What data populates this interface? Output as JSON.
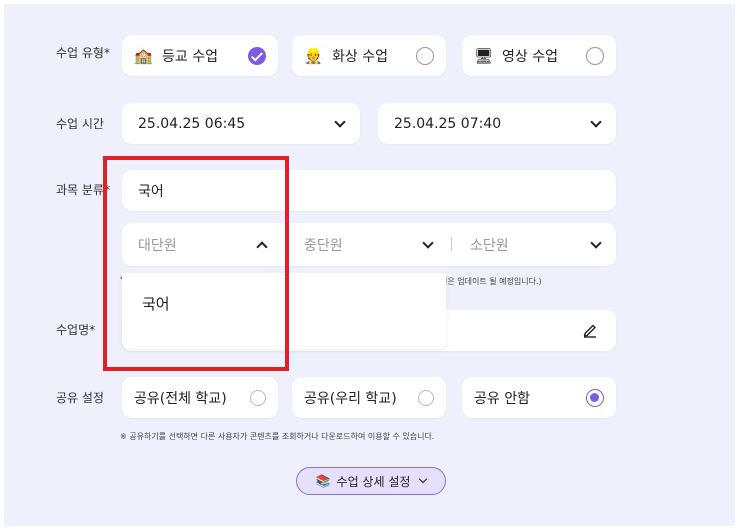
{
  "class_type": {
    "label": "수업 유형",
    "required_mark": "*",
    "options": [
      {
        "emoji": "🏫",
        "label": "등교 수업",
        "selected": true
      },
      {
        "emoji": "👷",
        "label": "화상 수업",
        "selected": false
      },
      {
        "emoji": "🖥",
        "label": "영상 수업",
        "selected": false
      }
    ]
  },
  "class_time": {
    "label": "수업 시간",
    "start": "25.04.25 06:45",
    "end": "25.04.25 07:40"
  },
  "subject": {
    "label": "과목 분류",
    "required_mark": "*",
    "value": "국어",
    "large_unit_placeholder": "대단원",
    "mid_unit_placeholder": "중단원",
    "small_unit_placeholder": "소단원",
    "note_start": "*",
    "note_end": "원은 업데이트 될 예정입니다.)",
    "dropdown_option": "국어"
  },
  "class_name": {
    "label": "수업명",
    "required_mark": "*"
  },
  "share": {
    "label": "공유 설정",
    "options": [
      {
        "label": "공유(전체 학교)",
        "selected": false
      },
      {
        "label": "공유(우리 학교)",
        "selected": false
      },
      {
        "label": "공유 안함",
        "selected": true
      }
    ],
    "note": "※ 공유하기를 선택하면 다른 사용자가 콘텐츠를 조회하거나 다운로드하여 이용할 수 있습니다."
  },
  "detail_button": {
    "emoji": "📚",
    "label": "수업 상세 설정"
  },
  "colors": {
    "accent": "#7b5ce0",
    "highlight_box": "#e31e25",
    "panel_bg": "#eef0fb"
  }
}
